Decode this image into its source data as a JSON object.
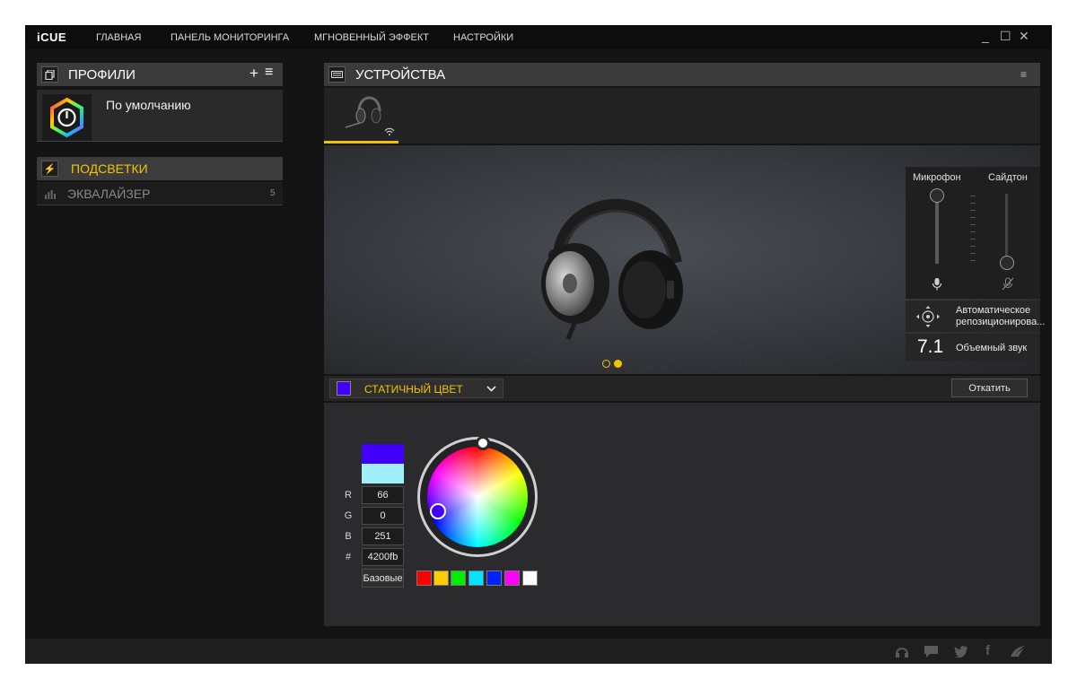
{
  "app": {
    "logo": "iCUE"
  },
  "nav": [
    "ГЛАВНАЯ",
    "ПАНЕЛЬ МОНИТОРИНГА",
    "МГНОВЕННЫЙ ЭФФЕКТ",
    "НАСТРОЙКИ"
  ],
  "window_controls": {
    "minimize": "_",
    "maximize": "☐",
    "close": "✕"
  },
  "profiles": {
    "title": "ПРОФИЛИ",
    "add": "+",
    "menu": "≡",
    "items": [
      {
        "name": "По умолчанию"
      }
    ]
  },
  "left_menu": [
    {
      "label": "ПОДСВЕТКИ",
      "icon": "lightning-icon",
      "active": true
    },
    {
      "label": "ЭКВАЛАЙЗЕР",
      "icon": "equalizer-icon",
      "count": "5",
      "active": false
    }
  ],
  "devices": {
    "title": "УСТРОЙСТВА",
    "menu": "≡"
  },
  "audio": {
    "mic_label": "Микрофон",
    "sidetone_label": "Сайдтон",
    "mic_level": 1.0,
    "sidetone_level": 0.0,
    "auto_reposition": "Автоматическое репозиционирова...",
    "surround_badge": "7.1",
    "surround_label": "Объемный звук"
  },
  "pager": {
    "count": 2,
    "active": 1
  },
  "effect": {
    "name": "СТАТИЧНЫЙ ЦВЕТ",
    "revert": "Откатить",
    "color": "#4200fb"
  },
  "color": {
    "current": "#4200fb",
    "previous": "#a0f0fa",
    "r_label": "R",
    "r": "66",
    "g_label": "G",
    "g": "0",
    "b_label": "B",
    "b": "251",
    "hex_label": "#",
    "hex": "4200fb",
    "base_button": "Базовые",
    "palette": [
      "#ff0000",
      "#ffcc00",
      "#00ee00",
      "#00e5ff",
      "#0022ff",
      "#ff00ff",
      "#ffffff"
    ]
  },
  "colors": {
    "accent": "#f2c400"
  }
}
